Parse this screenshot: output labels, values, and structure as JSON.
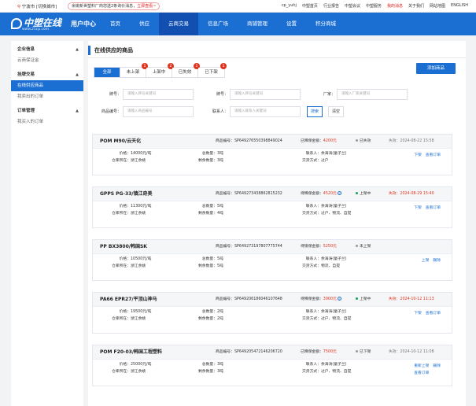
{
  "topbar": {
    "location": "宁波市 [切换城市]",
    "notice_text": "余姚新世塑料厂商您送2条询价消息，",
    "notice_link": "立即查看~",
    "links": [
      "cp_yuhj",
      "中塑首页",
      "行业报告",
      "中塑会议",
      "中塑服务",
      "我的消息",
      "关于我们",
      "网站地图",
      "ENGLISH"
    ]
  },
  "nav": {
    "logo": "中塑在线",
    "logo_url": "www.21cp.com",
    "user_center": "用户中心",
    "menu": [
      "首页",
      "供应",
      "云商交易",
      "信息广场",
      "商铺管理",
      "设置",
      "积分商城"
    ],
    "active_index": 2
  },
  "sidebar": {
    "groups": [
      {
        "title": "企业信息",
        "items": [
          "云商保证金"
        ]
      },
      {
        "title": "挂牌交易",
        "items": [
          "在线供应商品",
          "我卖出的订单"
        ]
      },
      {
        "title": "订单管理",
        "items": [
          "我买入的订单"
        ]
      }
    ],
    "active_item": "在线供应商品"
  },
  "main": {
    "title": "在线供应的商品",
    "add_button": "添加商品",
    "tabs": [
      {
        "label": "全部",
        "badge": ""
      },
      {
        "label": "未上架",
        "badge": "1"
      },
      {
        "label": "上架中",
        "badge": "2"
      },
      {
        "label": "已失效",
        "badge": "1"
      },
      {
        "label": "已下架",
        "badge": "1"
      }
    ],
    "filters": {
      "grade_label": "牌号：",
      "grade_placeholder": "请输入牌号关键词",
      "model_label": "牌号：",
      "model_placeholder": "请输入牌号关键词",
      "factory_label": "厂家：",
      "factory_placeholder": "请输入厂家关键词",
      "product_no_label": "商品编号：",
      "product_no_placeholder": "请输入商品编号",
      "contact_label": "联系人：",
      "contact_placeholder": "请输入联系人关键词",
      "search_button": "搜索",
      "clear_button": "清空"
    },
    "labels": {
      "price": "价格：",
      "total": "总数量：",
      "remain": "剩余数量：",
      "warehouse": "仓库所在：",
      "contact": "联系人：",
      "delivery": "交货方式："
    },
    "cards": [
      {
        "name": "POM M90/云天化",
        "no": "商品编号：SP649276550398849024",
        "dep_label": "已释保金额：",
        "dep_amount": "4200元",
        "dep_info": false,
        "status": "已失效",
        "status_dot": "gray",
        "exp": "失效：2024-08-22 15:58",
        "exp_red": false,
        "price": "14000元/吨",
        "total": "3吨",
        "remain": "3吨",
        "warehouse": "浙江余姚",
        "contact": "余海涛(童子兰)",
        "delivery": "过户",
        "actions": [
          "下架",
          "查看订单"
        ]
      },
      {
        "name": "GPPS PG-33/镇江奇美",
        "no": "商品编号：SP649273438862815232",
        "dep_label": "待释保金额：",
        "dep_amount": "4520元",
        "dep_info": true,
        "status": "上架中",
        "status_dot": "green",
        "exp": "失效：2024-08-29 15:40",
        "exp_red": true,
        "price": "11300元/吨",
        "total": "5吨",
        "remain": "4吨",
        "warehouse": "浙江余姚",
        "contact": "余海涛(童子兰)",
        "delivery": "过户、物流、自提",
        "actions": [
          "下架",
          "查看订单"
        ]
      },
      {
        "name": "PP BX3800/韩国SK",
        "no": "商品编号：SP649273197807775744",
        "dep_label": "待锁保金额：",
        "dep_amount": "5250元",
        "dep_info": false,
        "status": "未上架",
        "status_dot": "gray",
        "exp": "",
        "exp_red": false,
        "price": "10500元/吨",
        "total": "5吨",
        "remain": "5吨",
        "warehouse": "浙江余姚",
        "contact": "余海涛(童子兰)",
        "delivery": "物流、自提",
        "actions": [
          "上架",
          "删除"
        ]
      },
      {
        "name": "PA66 EPR27/平顶山神马",
        "no": "商品编号：SP649206186046107648",
        "dep_label": "待释保金额：",
        "dep_amount": "3900元",
        "dep_info": true,
        "status": "上架中",
        "status_dot": "green",
        "exp": "失效：2024-10-12 11:13",
        "exp_red": true,
        "price": "19500元/吨",
        "total": "2吨",
        "remain": "2吨",
        "warehouse": "浙江余姚",
        "contact": "余海涛(童子兰)",
        "delivery": "过户、物流、自提",
        "actions": [
          "下架",
          "查看订单"
        ]
      },
      {
        "name": "POM F20-03/韩国工程塑料",
        "no": "商品编号：SP649205472146206720",
        "dep_label": "已释保金额：",
        "dep_amount": "7500元",
        "dep_info": false,
        "status": "已下架",
        "status_dot": "gray",
        "exp": "失效：2024-10-12 11:08",
        "exp_red": false,
        "price": "25000元/吨",
        "total": "3吨",
        "remain": "3吨",
        "warehouse": "浙江余姚",
        "contact": "余海涛(童子兰)",
        "delivery": "过户、物流、自提",
        "actions": [
          "重新上架",
          "删除",
          "查看订单"
        ]
      }
    ]
  }
}
